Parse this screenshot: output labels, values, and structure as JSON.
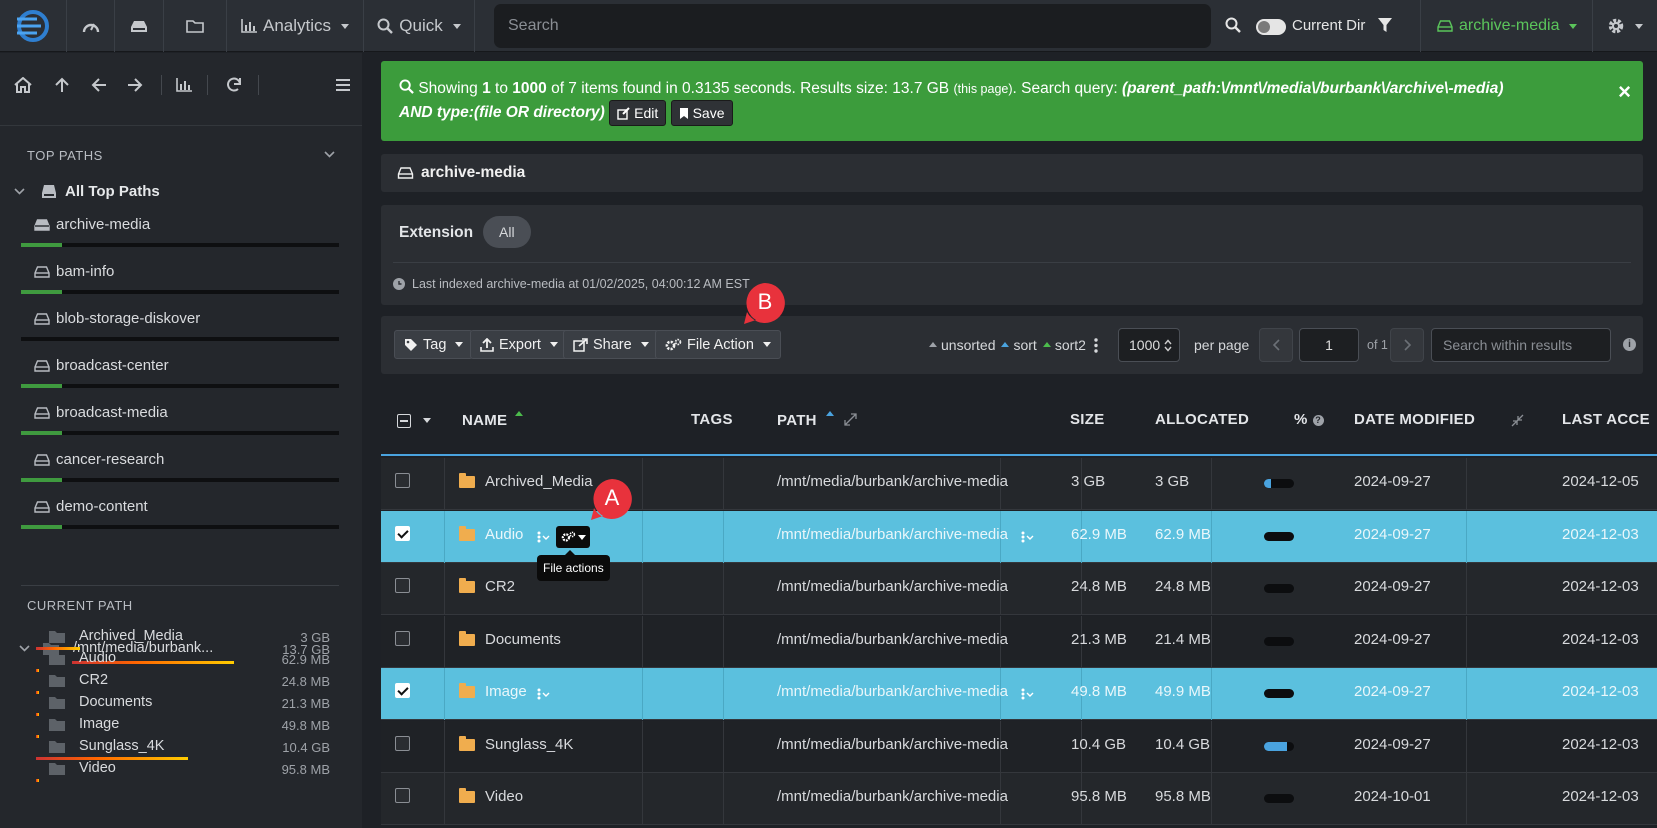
{
  "nav": {
    "analytics_label": "Analytics",
    "quick_label": "Quick",
    "search_placeholder": "Search",
    "current_dir_label": "Current Dir",
    "index_label": "archive-media",
    "accent_color": "#5bc55b"
  },
  "sidebar": {
    "top_paths_header": "TOP PATHS",
    "all_top_paths": "All Top Paths",
    "top_paths": [
      {
        "label": "archive-media",
        "usage": 0.13
      },
      {
        "label": "bam-info",
        "usage": 0.13
      },
      {
        "label": "blob-storage-diskover",
        "usage": 0.0
      },
      {
        "label": "broadcast-center",
        "usage": 0.13
      },
      {
        "label": "broadcast-media",
        "usage": 0.13
      },
      {
        "label": "cancer-research",
        "usage": 0.13
      },
      {
        "label": "demo-content",
        "usage": 0.13
      }
    ],
    "current_path_header": "CURRENT PATH",
    "current_path": {
      "label": "/mnt/media/burbank...",
      "size": "13.7 GB"
    },
    "children": [
      {
        "label": "Archived_Media",
        "size": "3 GB",
        "usage": 0.22
      },
      {
        "label": "Audio",
        "size": "62.9 MB",
        "usage": 0.005
      },
      {
        "label": "CR2",
        "size": "24.8 MB",
        "usage": 0.002
      },
      {
        "label": "Documents",
        "size": "21.3 MB",
        "usage": 0.002
      },
      {
        "label": "Image",
        "size": "49.8 MB",
        "usage": 0.004
      },
      {
        "label": "Sunglass_4K",
        "size": "10.4 GB",
        "usage": 0.76
      },
      {
        "label": "Video",
        "size": "95.8 MB",
        "usage": 0.007
      }
    ]
  },
  "alert": {
    "showing": "Showing",
    "from": "1",
    "to_word": "to",
    "to": "1000",
    "of_text": "of 7 items found in 0.3135 seconds. Results size: 13.7 GB",
    "this_page": "(this page)",
    "search_query_label": ". Search query:",
    "query_line1": "(parent_path:\\/mnt\\/media\\/burbank\\/archive\\-media)",
    "query_line2": "AND type:(file OR directory)",
    "edit_label": "Edit",
    "save_label": "Save",
    "close_symbol": "×"
  },
  "breadcrumb": {
    "label": "archive-media"
  },
  "filters": {
    "extension_label": "Extension",
    "extension_pill": "All",
    "last_indexed": "Last indexed archive-media at 01/02/2025, 04:00:12 AM EST"
  },
  "toolbar": {
    "tag_label": "Tag",
    "export_label": "Export",
    "share_label": "Share",
    "file_action_label": "File Action",
    "unsorted_label": "unsorted",
    "sort_label": "sort",
    "sort2_label": "sort2",
    "per_page_value": "1000",
    "per_page_label": "per page",
    "page_value": "1",
    "of_pages": "of 1",
    "search_within_placeholder": "Search within results"
  },
  "table": {
    "headers": {
      "name": "NAME",
      "tags": "TAGS",
      "path": "PATH",
      "size": "SIZE",
      "allocated": "ALLOCATED",
      "percent": "%",
      "date_modified": "DATE MODIFIED",
      "last_accessed": "LAST ACCE"
    },
    "rows": [
      {
        "name": "Archived_Media",
        "path": "/mnt/media/burbank/archive-media",
        "size": "3 GB",
        "allocated": "3 GB",
        "percent": 0.22,
        "modified": "2024-09-27",
        "accessed": "2024-12-05",
        "selected": false
      },
      {
        "name": "Audio",
        "path": "/mnt/media/burbank/archive-media",
        "size": "62.9 MB",
        "allocated": "62.9 MB",
        "percent": 0.0,
        "modified": "2024-09-27",
        "accessed": "2024-12-03",
        "selected": true
      },
      {
        "name": "CR2",
        "path": "/mnt/media/burbank/archive-media",
        "size": "24.8 MB",
        "allocated": "24.8 MB",
        "percent": 0.0,
        "modified": "2024-09-27",
        "accessed": "2024-12-03",
        "selected": false
      },
      {
        "name": "Documents",
        "path": "/mnt/media/burbank/archive-media",
        "size": "21.3 MB",
        "allocated": "21.4 MB",
        "percent": 0.0,
        "modified": "2024-09-27",
        "accessed": "2024-12-03",
        "selected": false
      },
      {
        "name": "Image",
        "path": "/mnt/media/burbank/archive-media",
        "size": "49.8 MB",
        "allocated": "49.9 MB",
        "percent": 0.0,
        "modified": "2024-09-27",
        "accessed": "2024-12-03",
        "selected": true
      },
      {
        "name": "Sunglass_4K",
        "path": "/mnt/media/burbank/archive-media",
        "size": "10.4 GB",
        "allocated": "10.4 GB",
        "percent": 0.76,
        "modified": "2024-09-27",
        "accessed": "2024-12-03",
        "selected": false
      },
      {
        "name": "Video",
        "path": "/mnt/media/burbank/archive-media",
        "size": "95.8 MB",
        "allocated": "95.8 MB",
        "percent": 0.0,
        "modified": "2024-10-01",
        "accessed": "2024-12-03",
        "selected": false
      }
    ]
  },
  "tooltip": {
    "file_actions": "File actions"
  },
  "markers": {
    "a": "A",
    "b": "B",
    "color": "#e8323c"
  }
}
